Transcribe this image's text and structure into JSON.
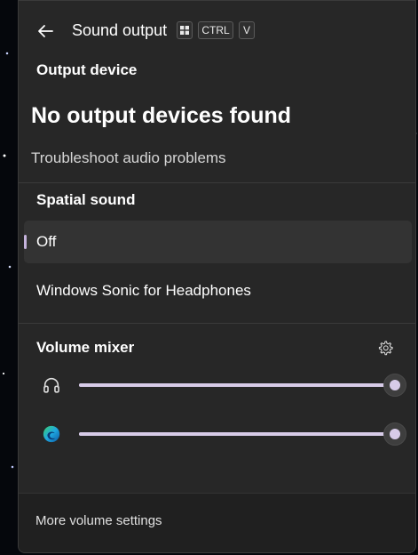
{
  "header": {
    "title": "Sound output",
    "keys": {
      "win": "⊞",
      "ctrl": "CTRL",
      "v": "V"
    },
    "back_icon": "back-arrow-icon"
  },
  "output_device": {
    "heading": "Output device",
    "status": "No output devices found",
    "troubleshoot": "Troubleshoot audio problems"
  },
  "spatial_sound": {
    "heading": "Spatial sound",
    "options": [
      {
        "label": "Off",
        "selected": true
      },
      {
        "label": "Windows Sonic for Headphones",
        "selected": false
      }
    ]
  },
  "volume_mixer": {
    "heading": "Volume mixer",
    "settings_icon": "gear-icon",
    "apps": [
      {
        "icon": "headphones-icon",
        "volume": 100
      },
      {
        "icon": "edge-browser-icon",
        "volume": 100
      }
    ]
  },
  "footer": {
    "label": "More volume settings"
  },
  "colors": {
    "accent": "#d7cbe8",
    "panel": "#272727",
    "footer": "#202020"
  }
}
